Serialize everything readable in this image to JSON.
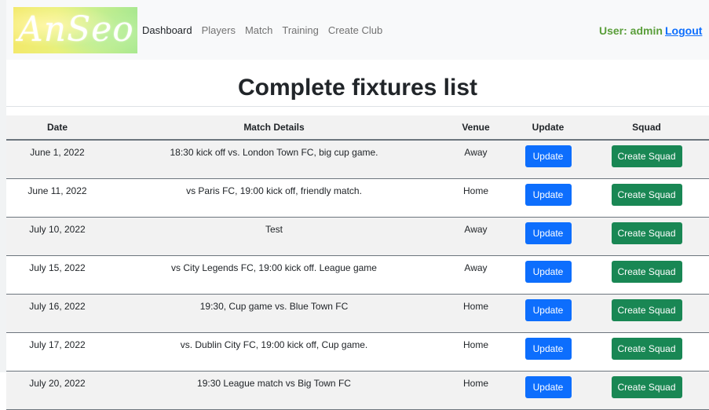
{
  "brand": {
    "logo_text": "AnSeo"
  },
  "nav": {
    "items": [
      {
        "label": "Dashboard",
        "active": true
      },
      {
        "label": "Players"
      },
      {
        "label": "Match"
      },
      {
        "label": "Training"
      },
      {
        "label": "Create Club"
      }
    ],
    "user_label": "User: admin",
    "logout_label": "Logout"
  },
  "page": {
    "title": "Complete fixtures list"
  },
  "table": {
    "headers": [
      "Date",
      "Match Details",
      "Venue",
      "Update",
      "Squad"
    ],
    "update_label": "Update",
    "squad_label": "Create Squad",
    "rows": [
      {
        "date": "June 1, 2022",
        "details": "18:30 kick off vs. London Town FC, big cup game.",
        "venue": "Away"
      },
      {
        "date": "June 11, 2022",
        "details": "vs Paris FC, 19:00 kick off, friendly match.",
        "venue": "Home"
      },
      {
        "date": "July 10, 2022",
        "details": "Test",
        "venue": "Away"
      },
      {
        "date": "July 15, 2022",
        "details": "vs City Legends FC, 19:00 kick off. League game",
        "venue": "Away"
      },
      {
        "date": "July 16, 2022",
        "details": "19:30, Cup game vs. Blue Town FC",
        "venue": "Home"
      },
      {
        "date": "July 17, 2022",
        "details": "vs. Dublin City FC, 19:00 kick off, Cup game.",
        "venue": "Home"
      },
      {
        "date": "July 20, 2022",
        "details": "19:30 League match vs Big Town FC",
        "venue": "Home"
      }
    ]
  },
  "colors": {
    "update_button": "#0d6efd",
    "squad_button": "#198754",
    "user_label": "#5a9e3a",
    "logout_link": "#0d6efd"
  }
}
